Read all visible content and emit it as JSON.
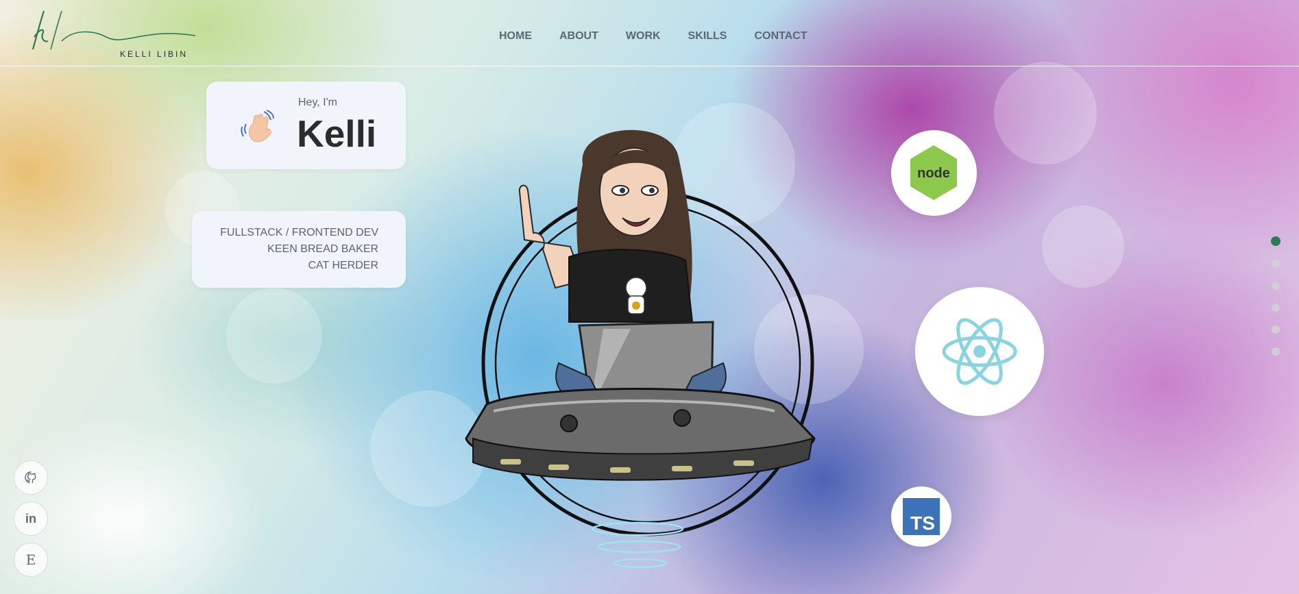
{
  "brand": {
    "monogram": "kl",
    "name": "KELLI LIBIN",
    "colors": {
      "accent": "#2f7a5a"
    }
  },
  "nav": {
    "items": [
      "HOME",
      "ABOUT",
      "WORK",
      "SKILLS",
      "CONTACT"
    ]
  },
  "hero": {
    "greeting": "Hey, I'm",
    "name": "Kelli",
    "wave_icon": "waving-hand-icon",
    "roles": [
      "FULLSTACK / FRONTEND DEV",
      "KEEN BREAD BAKER",
      "CAT HERDER"
    ]
  },
  "tech_icons": [
    {
      "icon": "nodejs-icon",
      "label": "node"
    },
    {
      "icon": "react-icon"
    },
    {
      "icon": "typescript-icon",
      "label": "TS"
    }
  ],
  "section_dots": {
    "count": 6,
    "active_index": 0
  },
  "social": [
    {
      "icon": "github-icon"
    },
    {
      "icon": "linkedin-icon",
      "label": "in"
    },
    {
      "icon": "etsy-icon",
      "label": "E"
    }
  ]
}
